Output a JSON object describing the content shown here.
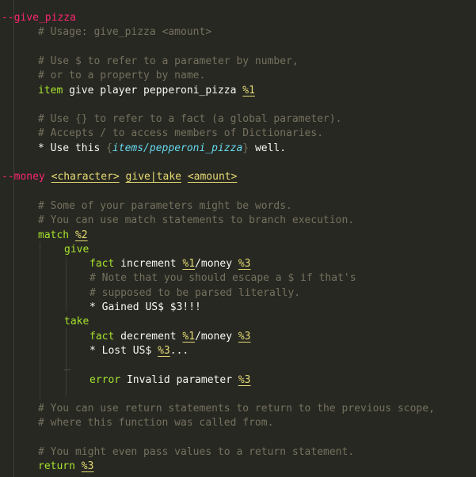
{
  "colors": {
    "background": "#272822",
    "comment": "#75715e",
    "header": "#f92672",
    "keyword": "#a6e22e",
    "text": "#f8f8f2",
    "parameter": "#e6db74",
    "variable": "#66d9ef"
  },
  "lines": [
    {
      "indent": 2,
      "segs": [
        {
          "t": "--give_pizza",
          "c": "header"
        }
      ]
    },
    {
      "indent": 48,
      "segs": [
        {
          "t": "# Usage: give_pizza <amount>",
          "c": "comment"
        }
      ]
    },
    {
      "blank": true
    },
    {
      "indent": 48,
      "segs": [
        {
          "t": "# Use $ to refer to a parameter by number,",
          "c": "comment"
        }
      ]
    },
    {
      "indent": 48,
      "segs": [
        {
          "t": "# or to a property by name.",
          "c": "comment"
        }
      ]
    },
    {
      "indent": 48,
      "segs": [
        {
          "t": "item",
          "c": "kw"
        },
        {
          "t": " give player pepperoni_pizza ",
          "c": "text"
        },
        {
          "t": "%1",
          "c": "param"
        }
      ]
    },
    {
      "blank": true
    },
    {
      "indent": 48,
      "segs": [
        {
          "t": "# Use {} to refer to a fact (a global parameter).",
          "c": "comment"
        }
      ]
    },
    {
      "indent": 48,
      "segs": [
        {
          "t": "# Accepts / to access members of Dictionaries.",
          "c": "comment"
        }
      ]
    },
    {
      "indent": 48,
      "segs": [
        {
          "t": "* Use this ",
          "c": "text"
        },
        {
          "t": "{",
          "c": "brace"
        },
        {
          "t": "items/pepperoni_pizza",
          "c": "italic-var"
        },
        {
          "t": "}",
          "c": "brace"
        },
        {
          "t": " well.",
          "c": "text"
        }
      ]
    },
    {
      "blank": true
    },
    {
      "indent": 2,
      "segs": [
        {
          "t": "--money",
          "c": "header"
        },
        {
          "t": " ",
          "c": "text"
        },
        {
          "t": "<character>",
          "c": "param"
        },
        {
          "t": " ",
          "c": "text"
        },
        {
          "t": "give|take",
          "c": "param"
        },
        {
          "t": " ",
          "c": "text"
        },
        {
          "t": "<amount>",
          "c": "param"
        }
      ]
    },
    {
      "blank": true
    },
    {
      "indent": 48,
      "segs": [
        {
          "t": "# Some of your parameters might be words.",
          "c": "comment"
        }
      ]
    },
    {
      "indent": 48,
      "segs": [
        {
          "t": "# You can use match statements to branch execution.",
          "c": "comment"
        }
      ]
    },
    {
      "indent": 48,
      "segs": [
        {
          "t": "match",
          "c": "kw"
        },
        {
          "t": " ",
          "c": "text"
        },
        {
          "t": "%2",
          "c": "param"
        }
      ]
    },
    {
      "indent": 81,
      "segs": [
        {
          "t": "give",
          "c": "kw"
        }
      ]
    },
    {
      "indent": 113,
      "segs": [
        {
          "t": "fact",
          "c": "kw"
        },
        {
          "t": " increment ",
          "c": "text"
        },
        {
          "t": "%1",
          "c": "param"
        },
        {
          "t": "/money ",
          "c": "text"
        },
        {
          "t": "%3",
          "c": "param"
        }
      ]
    },
    {
      "indent": 113,
      "segs": [
        {
          "t": "# Note that you should escape a $ if that's",
          "c": "comment"
        }
      ]
    },
    {
      "indent": 113,
      "segs": [
        {
          "t": "# supposed to be parsed literally.",
          "c": "comment"
        }
      ]
    },
    {
      "indent": 113,
      "segs": [
        {
          "t": "* Gained US$ $3!!!",
          "c": "text"
        }
      ]
    },
    {
      "indent": 81,
      "segs": [
        {
          "t": "take",
          "c": "kw"
        }
      ]
    },
    {
      "indent": 113,
      "segs": [
        {
          "t": "fact",
          "c": "kw"
        },
        {
          "t": " decrement ",
          "c": "text"
        },
        {
          "t": "%1",
          "c": "param"
        },
        {
          "t": "/money ",
          "c": "text"
        },
        {
          "t": "%3",
          "c": "param"
        }
      ]
    },
    {
      "indent": 113,
      "segs": [
        {
          "t": "* Lost US$ ",
          "c": "text"
        },
        {
          "t": "%3",
          "c": "param"
        },
        {
          "t": "...",
          "c": "text"
        }
      ]
    },
    {
      "indent": 81,
      "segs": [
        {
          "t": "_",
          "c": "dash"
        }
      ]
    },
    {
      "indent": 113,
      "segs": [
        {
          "t": "error",
          "c": "kw"
        },
        {
          "t": " Invalid parameter ",
          "c": "text"
        },
        {
          "t": "%3",
          "c": "param"
        }
      ]
    },
    {
      "blank": true
    },
    {
      "indent": 48,
      "segs": [
        {
          "t": "# You can use return statements to return to the previous scope,",
          "c": "comment"
        }
      ]
    },
    {
      "indent": 48,
      "segs": [
        {
          "t": "# where this function was called from.",
          "c": "comment"
        }
      ]
    },
    {
      "blank": true
    },
    {
      "indent": 48,
      "segs": [
        {
          "t": "# You might even pass values to a return statement.",
          "c": "comment"
        }
      ]
    },
    {
      "indent": 48,
      "segs": [
        {
          "t": "return",
          "c": "kw"
        },
        {
          "t": " ",
          "c": "text"
        },
        {
          "t": "%3",
          "c": "param"
        }
      ]
    }
  ]
}
